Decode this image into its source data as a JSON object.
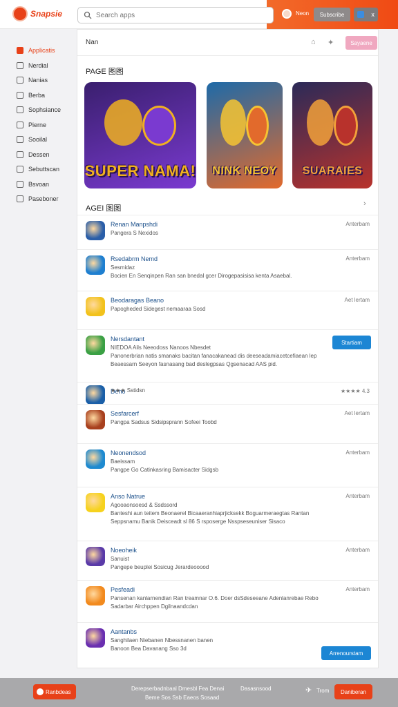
{
  "header": {
    "logo_text": "Snapsie",
    "search_placeholder": "Search apps",
    "user_label": "Neon",
    "primary_button": "Subscribe",
    "square_label": "x"
  },
  "sidebar": {
    "items": [
      {
        "label": "Applicatis",
        "active": true
      },
      {
        "label": "Nerdial"
      },
      {
        "label": "Nanias"
      },
      {
        "label": "Berba"
      },
      {
        "label": "Sophsiance"
      },
      {
        "label": "Pierne"
      },
      {
        "label": "Sooilal"
      },
      {
        "label": "Dessen"
      },
      {
        "label": "Sebuttscan"
      },
      {
        "label": "Bsvoan"
      },
      {
        "label": "Paseboner"
      }
    ]
  },
  "main": {
    "title": "Nan",
    "head_button": "Sayaene",
    "featured_label": "PAGE 图图",
    "featured": [
      {
        "title": "SUPER NAMA!",
        "colors": [
          "#3a1f6e",
          "#7a3ad0",
          "#f0b020"
        ]
      },
      {
        "title": "NINK NEOY",
        "colors": [
          "#1e6aa8",
          "#e26a2c",
          "#f6c432"
        ]
      },
      {
        "title": "SUARAIES",
        "colors": [
          "#2b2a58",
          "#b8322c",
          "#f2a13a"
        ]
      }
    ],
    "list_label": "AGEI 图图",
    "apps": [
      {
        "name": "Renan Manpshdi",
        "line1": "Pangera S Nexidos",
        "meta": "Anterbam",
        "icon": "#2a5ea8"
      },
      {
        "name": "Rsedabrm Nemd",
        "sub": "Sesmidaz",
        "line1": "Bocien En Senqinpen Ran san bnedal gcer Dirogepasisisa kenta Asaebal.",
        "meta": "Anterbam",
        "icon": "#1e7fd0"
      },
      {
        "name": "Beodaragas Beano",
        "line1": "Papogheded Sidegest nemaaraa Sosd",
        "meta": "Aet lertam",
        "icon": "#f2c21c"
      },
      {
        "name": "Nersdantant",
        "sub": "NIEDOA Ails Neeodoss Nanoos Nbesdet",
        "line1": "Panonerbrian natis smanaks bacitan fanacakanead dis deeseadamiacetcefiaean lep",
        "line2": "Beaessarn Seeyon fasnasang bad deslegpsas Qgsenacad AAS pid.",
        "meta": "Strartiam",
        "icon": "#3aa044",
        "button": "Startiam"
      },
      {
        "name": "Deno",
        "sub_stars": "★★★ Sstidsn",
        "meta": "★★★★ 4.3",
        "icon": "#1a5fa8"
      },
      {
        "name": "Sesfarcerf",
        "line1": "Pangpa Sadsus Sidsipsprann Sofeei Toobd",
        "meta": "Aet lertam",
        "icon": "#a8401e"
      },
      {
        "name": "Neonendsod",
        "sub": "Baeissam",
        "line1": "Pangpe Go Catinkasring Bamisacter Sidgsb",
        "meta": "Anterbam",
        "icon": "#1e8ad0"
      },
      {
        "name": "Anso Natrue",
        "sub": "Agooaonsoesd & Ssdssord",
        "line1": "Banteshi aun teitem Beonaerel Bicaaeranhiaprjicksekk Boguarmeraegtas Rantan",
        "line2": "Seppsnamu Banik Deisceadt sl 86 S rsposerge Nsspseseuniser Sisaco",
        "meta": "Anterbam",
        "icon": "#f6d21e"
      },
      {
        "name": "Noeoheik",
        "sub": "Sanuist",
        "line1": "Pangepe beuplei Sosicug Jerardeooood",
        "meta": "Anterbam",
        "icon": "#5a3aa8"
      },
      {
        "name": "Pesfeadi",
        "line1": "Pansenan kanlarnendian Ran treamnar O.6. Doer dsSdeseeane Adenlanrebae Rebo",
        "line2": "Sadarbar Airchppen Dgilnaandcdan",
        "meta": "Anterbam",
        "icon": "#f28a1e"
      },
      {
        "name": "Aantanbs",
        "sub": "Sanghilaen Niebanen Nbessnanen banen",
        "line1": "Banoon Bea Davanang Sso 3d",
        "meta": "Anterbam",
        "icon": "#6a2fb0",
        "button": "Arrenourstam"
      }
    ]
  },
  "footer": {
    "logo_label": "Ranbdeas",
    "center_line1": "Derepserbadnbaal Dmesbl Fea Denai",
    "center_line2": "Beme Sos Ssb Eaeos Sosaad",
    "right_text": "Dasasnsood",
    "bird_label": "Trom",
    "button": "Daniberan"
  }
}
